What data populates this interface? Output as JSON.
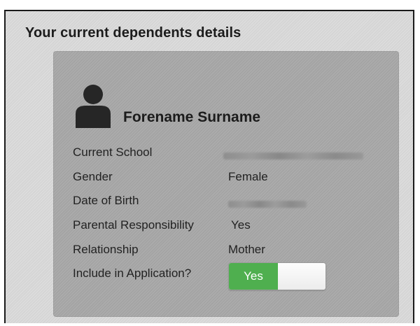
{
  "section": {
    "title": "Your current dependents details"
  },
  "dependent": {
    "name": "Forename Surname",
    "avatar_icon": "person-icon",
    "fields": {
      "current_school": {
        "label": "Current School",
        "value": ""
      },
      "gender": {
        "label": "Gender",
        "value": "Female"
      },
      "date_of_birth": {
        "label": "Date of Birth",
        "value": ""
      },
      "parental_responsibility": {
        "label": "Parental Responsibility",
        "value": "Yes"
      },
      "relationship": {
        "label": "Relationship",
        "value": "Mother"
      },
      "include_in_application": {
        "label": "Include in Application?",
        "toggle_label": "Yes",
        "toggle_on": true
      }
    }
  },
  "colors": {
    "page_background": "#dcdcdc",
    "card_background": "#a9a9a9",
    "toggle_on": "#4faf4f",
    "text": "#222222"
  }
}
